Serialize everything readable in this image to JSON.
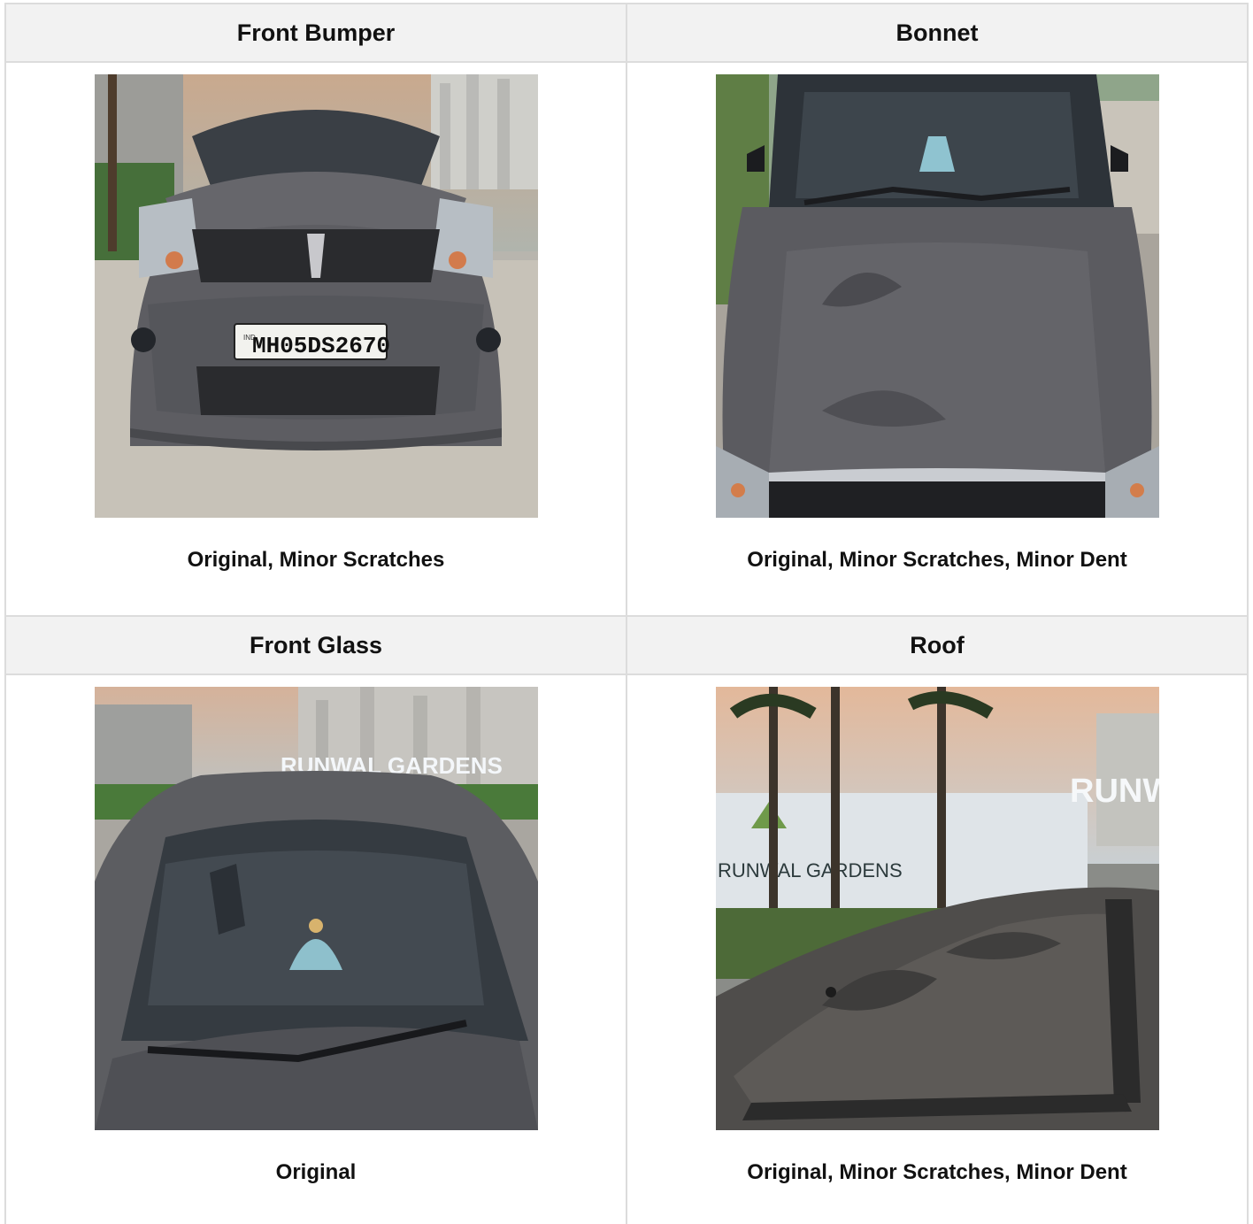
{
  "panels": [
    {
      "title": "Front Bumper",
      "photo": "car-front-bumper-photo",
      "plate_text": "MH05DS2670",
      "plate_prefix": "IND",
      "status": "Original, Minor Scratches"
    },
    {
      "title": "Bonnet",
      "photo": "car-bonnet-photo",
      "status": "Original, Minor Scratches, Minor Dent"
    },
    {
      "title": "Front Glass",
      "photo": "car-front-glass-photo",
      "sign_text": "RUNWAL GARDENS",
      "status": "Original"
    },
    {
      "title": "Roof",
      "photo": "car-roof-photo",
      "sign_text": "RUNWAL GARDENS",
      "sign_text_2": "RUNW",
      "status": "Original, Minor Scratches, Minor Dent"
    }
  ],
  "colors": {
    "header_bg": "#f2f2f2",
    "border": "#dcdcdc",
    "car_body": "#5a5a5e",
    "sky": "#d7b9a3"
  }
}
